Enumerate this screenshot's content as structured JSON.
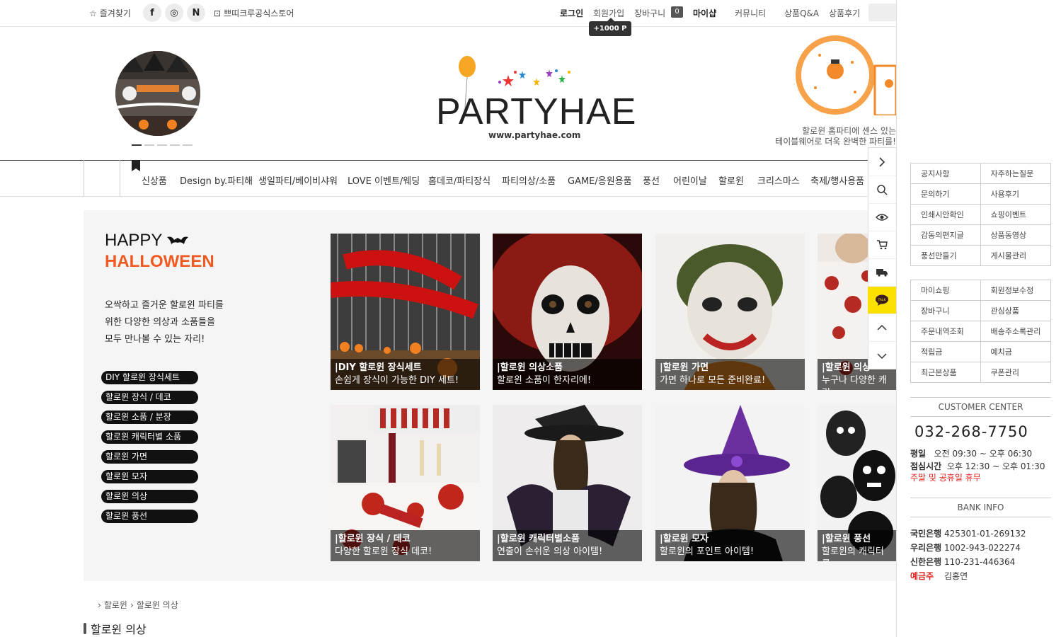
{
  "topbar": {
    "favorite": "즐겨찾기",
    "sns": [
      "f",
      "◎",
      "N"
    ],
    "store": "쁘띠크루공식스토어",
    "menu": {
      "login": "로그인",
      "join": "회원가입",
      "cart": "장바구니",
      "cart_count": "0",
      "mypage": "마이샵",
      "community": "커뮤니티",
      "qna": "상품Q&A",
      "review": "상품후기"
    },
    "points_badge": "+1000 P"
  },
  "header": {
    "logo_text": "PARTYHAE",
    "logo_url": "www.partyhae.com",
    "right_banner_caption_line1": "할로윈 홈파티에 센스 있는",
    "right_banner_caption_line2": "테이블웨어로 더욱 완벽한 파티를!"
  },
  "nav": {
    "items": [
      "신상품",
      "Design by.파티해",
      "생일파티/베이비샤워",
      "LOVE 이벤트/웨딩",
      "홈데코/파티장식",
      "파티의상/소품",
      "GAME/응원용품",
      "풍선",
      "어린이날",
      "할로윈",
      "크리스마스",
      "축제/행사용품"
    ]
  },
  "hero": {
    "title1": "HAPPY",
    "title2": "HALLOWEEN",
    "desc": [
      "오싹하고 즐거운 할로윈 파티를",
      "위한 다양한 의상과 소품들을",
      "모두 만나볼 수 있는 자리!"
    ],
    "pills": [
      "DIY 할로윈 장식세트",
      "할로윈 장식 / 데코",
      "할로윈 소품 / 분장",
      "할로윈 캐릭터별 소품",
      "할로윈 가면",
      "할로윈 모자",
      "할로윈 의상",
      "할로윈 풍선"
    ],
    "cards": [
      {
        "title": "|DIY 할로윈 장식세트",
        "sub": "손쉽게 장식이 가능한 DIY 세트!"
      },
      {
        "title": "|할로윈 의상소품",
        "sub": "할로윈 소품이 한자리에!"
      },
      {
        "title": "|할로윈 가면",
        "sub": "가면 하나로 모든 준비완료!"
      },
      {
        "title": "|할로윈 의상",
        "sub": "누구나 다양한 캐릭"
      },
      {
        "title": "|할로윈 장식 / 데코",
        "sub": "다양한 할로윈 장식 데코!"
      },
      {
        "title": "|할로윈 캐릭터별소품",
        "sub": "연출이 손쉬운 의상 아이템!"
      },
      {
        "title": "|할로윈 모자",
        "sub": "할로윈의 포인트 아이템!"
      },
      {
        "title": "|할로윈 풍선",
        "sub": "할로윈의 캐릭터를"
      }
    ]
  },
  "breadcrumb": {
    "items": [
      "할로윈",
      "할로윈 의상"
    ]
  },
  "page_title": "할로윈 의상",
  "quickbar": {
    "icons": [
      "chevron-right-icon",
      "search-icon",
      "eye-icon",
      "cart-icon",
      "truck-icon",
      "kakao-talk-icon",
      "chevron-up-icon",
      "chevron-down-icon"
    ],
    "talk": "TALK"
  },
  "right_panel": {
    "grid1": [
      [
        "공지사항",
        "자주하는질문"
      ],
      [
        "문의하기",
        "사용후기"
      ],
      [
        "인쇄시안확인",
        "쇼핑이벤트"
      ],
      [
        "감동의편지글",
        "상품동영상"
      ],
      [
        "풍선만들기",
        "게시물관리"
      ]
    ],
    "grid2": [
      [
        "마이쇼핑",
        "회원정보수정"
      ],
      [
        "장바구니",
        "관심상품"
      ],
      [
        "주문내역조회",
        "배송주소록관리"
      ],
      [
        "적립금",
        "예치금"
      ],
      [
        "최근본상품",
        "쿠폰관리"
      ]
    ],
    "customer_center": "CUSTOMER CENTER",
    "phone": "032-268-7750",
    "hours_label": "평일",
    "hours": "오전 09:30 ~ 오후 06:30",
    "lunch_label": "점심시간",
    "lunch": "오후 12:30 ~ 오후 01:30",
    "holiday": "주말 및 공휴일 휴무",
    "bank_info": "BANK INFO",
    "banks": [
      [
        "국민은행",
        "425301-01-269132"
      ],
      [
        "우리은행",
        "1002-943-022274"
      ],
      [
        "신한은행",
        "110-231-446364"
      ]
    ],
    "depositor_label": "예금주",
    "depositor": "김홍연"
  },
  "colors": {
    "accent": "#f05a20",
    "talk": "#fae100",
    "red": "#e0211b"
  }
}
